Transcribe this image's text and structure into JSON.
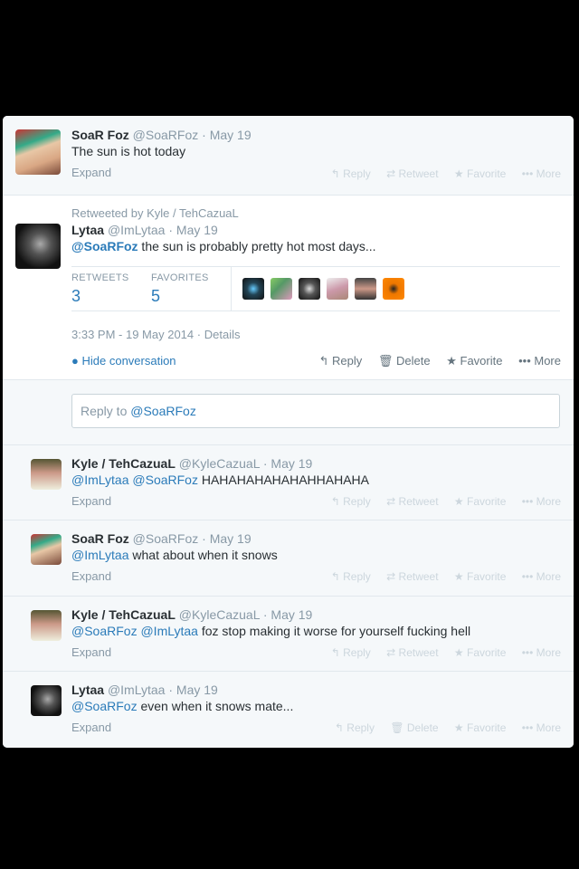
{
  "tweets": {
    "t1": {
      "name": "SoaR Foz",
      "handle": "@SoaRFoz",
      "date": "May 19",
      "text": "The sun is hot today",
      "expand": "Expand"
    },
    "t2": {
      "retweeted_by": "Retweeted by Kyle / TehCazuaL",
      "name": "Lytaa",
      "handle": "@ImLytaa",
      "date": "May 19",
      "mention": "@SoaRFoz",
      "text": " the sun is probably pretty hot most days...",
      "retweets_label": "RETWEETS",
      "retweets": "3",
      "favorites_label": "FAVORITES",
      "favorites": "5",
      "timestamp": "3:33 PM - 19 May 2014",
      "details": "Details",
      "hide_conversation": "Hide conversation"
    },
    "reply_box": {
      "prefix": "Reply to ",
      "mention": "@SoaRFoz"
    },
    "t3": {
      "name": "Kyle / TehCazuaL",
      "handle": "@KyleCazuaL",
      "date": "May 19",
      "m1": "@ImLytaa",
      "m2": "@SoaRFoz",
      "text": " HAHAHAHAHAHAHHAHAHA",
      "expand": "Expand"
    },
    "t4": {
      "name": "SoaR Foz",
      "handle": "@SoaRFoz",
      "date": "May 19",
      "m1": "@ImLytaa",
      "text": " what about when it snows",
      "expand": "Expand"
    },
    "t5": {
      "name": "Kyle / TehCazuaL",
      "handle": "@KyleCazuaL",
      "date": "May 19",
      "m1": "@SoaRFoz",
      "m2": "@ImLytaa",
      "text": " foz stop making it worse for yourself fucking hell",
      "expand": "Expand"
    },
    "t6": {
      "name": "Lytaa",
      "handle": "@ImLytaa",
      "date": "May 19",
      "m1": "@SoaRFoz",
      "text": " even when it snows mate...",
      "expand": "Expand"
    }
  },
  "actions": {
    "reply": "Reply",
    "retweet": "Retweet",
    "favorite": "Favorite",
    "more": "More",
    "delete": "Delete",
    "reply_icon": "reply-arrow-icon",
    "retweet_icon": "retweet-icon",
    "favorite_icon": "star-icon",
    "more_icon": "ellipsis-icon",
    "delete_icon": "trash-icon"
  },
  "colors": {
    "link": "#2b7bb9",
    "meta": "#8899a6",
    "faint": "#ccd6dd",
    "bg_grey": "#f5f8fa"
  }
}
